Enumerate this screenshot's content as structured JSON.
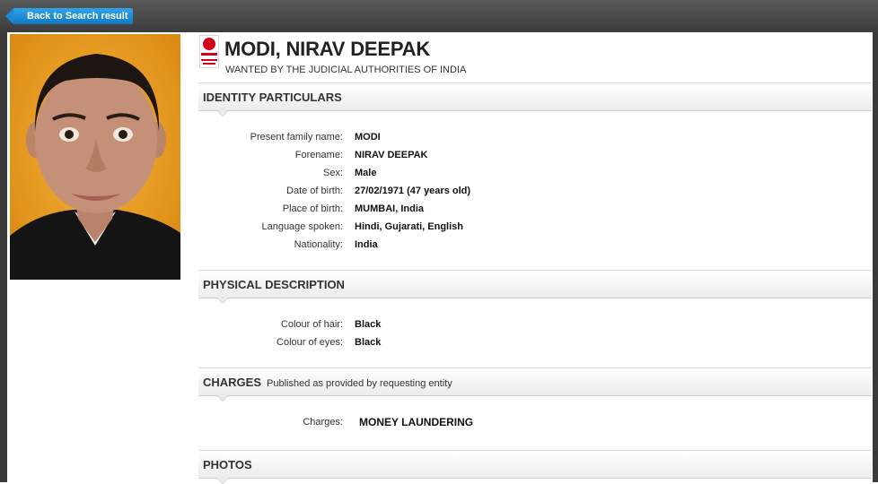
{
  "nav": {
    "back_label": "Back to Search result"
  },
  "notice": {
    "name": "MODI, NIRAV DEEPAK",
    "subtitle": "WANTED BY THE JUDICIAL AUTHORITIES OF INDIA"
  },
  "identity": {
    "title": "IDENTITY PARTICULARS",
    "rows": [
      {
        "label": "Present family name:",
        "value": "MODI"
      },
      {
        "label": "Forename:",
        "value": "NIRAV DEEPAK"
      },
      {
        "label": "Sex:",
        "value": "Male"
      },
      {
        "label": "Date of birth:",
        "value": "27/02/1971 (47 years old)"
      },
      {
        "label": "Place of birth:",
        "value": "MUMBAI, India"
      },
      {
        "label": "Language spoken:",
        "value": "Hindi, Gujarati, English"
      },
      {
        "label": "Nationality:",
        "value": "India"
      }
    ]
  },
  "physical": {
    "title": "PHYSICAL DESCRIPTION",
    "rows": [
      {
        "label": "Colour of hair:",
        "value": "Black"
      },
      {
        "label": "Colour of eyes:",
        "value": "Black"
      }
    ]
  },
  "charges": {
    "title": "CHARGES",
    "note": "Published as provided by requesting entity",
    "rows": [
      {
        "label": "Charges:",
        "value": "MONEY LAUNDERING"
      }
    ]
  },
  "photos": {
    "title": "PHOTOS"
  },
  "colors": {
    "button": "#1a8ad5",
    "notice_red": "#d0021b",
    "frame": "#3a3a3a"
  }
}
